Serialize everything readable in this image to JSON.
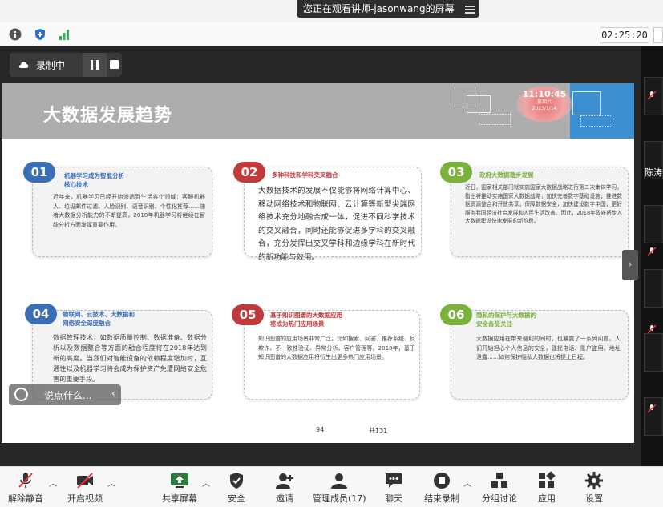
{
  "share_banner": {
    "text": "您正在观看讲师-jasonwang的屏幕"
  },
  "clock": "02:25:20",
  "recording": {
    "label": "录制中"
  },
  "slide": {
    "title": "大数据发展趋势",
    "stamp_time": "11:10:45",
    "stamp_day": "星期六",
    "stamp_date": "2023/1/14",
    "page_current": "94",
    "page_total": "共131",
    "cards": [
      {
        "num": "01",
        "title": "机器学习成为智能分析\n核心技术",
        "body": "近年来，机器学习已经开始渗透到生活各个领域：客服机器人、垃圾邮件过滤、人脸识别、语音识别、个性化推荐……随着大数据分析能力的不断提高，2018年机器学习将继续在智能分析方面发挥重要作用。"
      },
      {
        "num": "02",
        "title": "多种科技和学科交叉融合",
        "body": "大数据技术的发展不仅能够将网络计算中心、移动网络技术和物联网、云计算等新型尖端网络技术充分地融合成一体，促进不同科学技术的交叉融合，同时还能够促进多学科的交叉融合，充分发挥出交叉学科和边缘学科在新时代的新功能与效用。"
      },
      {
        "num": "03",
        "title": "政府大数据稳步发展",
        "body": "近日，国家相关部门就实施国家大数据战略进行第二次集体学习，指出将推动实施国家大数据战略，加快完善数字基础设施，推进数据资源整合和开放共享，保障数据安全，加快建设数字中国，更好服务我国经济社会发展和人民生活改善。因此，2018年政府将步入大数据建设快速发展的新阶段。"
      },
      {
        "num": "04",
        "title": "物联网、云技术、大数据和\n网络安全深度融合",
        "body": "数据管理技术，如数据质量控制、数据准备、数据分析以及数据整合等方面的融合程度将在2018年达到新的高度。当我们对智能设备的依赖程度增加时，互通性以及机器学习将会成为保护资产免遭网络安全危害的重要手段。"
      },
      {
        "num": "05",
        "title": "基于知识图谱的大数据应用\n将成为热门应用场景",
        "body": "知识图谱的应用场景非常广泛，比如搜索、问答、推荐系统、反欺诈、不一致性验证、异常分析、客户管理等。2018年，基于知识图谱的大数据应用将衍生出更多热门应用场景。"
      },
      {
        "num": "06",
        "title": "隐私的保护与大数据的\n安全备受关注",
        "body": "大数据应用在带来便利的同时，也暴露了一系列问题。人们开始担心个人信息的安全，骚扰电话、账户盗用、地址泄露……如何保护隐私大数据也将提上日程。"
      }
    ],
    "card_colors": [
      "#3a6eb5",
      "#c0393b",
      "#7ab23c",
      "#3a6eb5",
      "#c0393b",
      "#7ab23c"
    ]
  },
  "chat": {
    "placeholder": "说点什么..."
  },
  "right_panel": {
    "name": "陈涛"
  },
  "toolbar": {
    "mute": "解除静音",
    "video": "开启视频",
    "share": "共享屏幕",
    "security": "安全",
    "invite": "邀请",
    "members": "管理成员(17)",
    "chat": "聊天",
    "end_record": "结束录制",
    "breakout": "分组讨论",
    "apps": "应用",
    "settings": "设置"
  },
  "icons": [
    "info-icon",
    "shield-icon",
    "signal-icon",
    "cloud-icon",
    "pause-icon",
    "stop-icon",
    "emoji-icon",
    "chevron-left-icon",
    "chevron-right-icon",
    "mic-off-icon",
    "video-off-icon",
    "share-screen-icon",
    "security-icon",
    "invite-icon",
    "members-icon",
    "chat-icon",
    "record-stop-icon",
    "breakout-icon",
    "apps-icon",
    "gear-icon"
  ]
}
